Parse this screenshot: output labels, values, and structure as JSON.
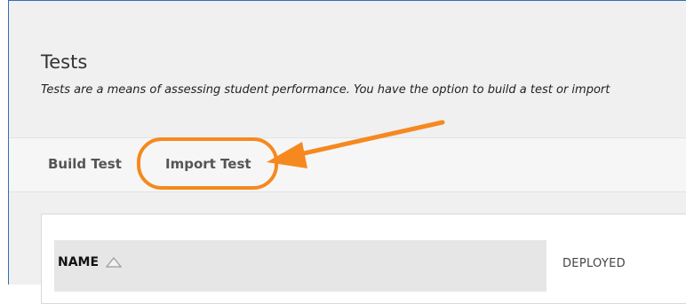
{
  "page": {
    "title": "Tests",
    "description": "Tests are a means of assessing student performance. You have the option to build a test or import"
  },
  "actions": {
    "build_label": "Build Test",
    "import_label": "Import Test"
  },
  "table": {
    "columns": [
      "NAME",
      "DEPLOYED"
    ],
    "sort_icon": "triangle-up-icon"
  },
  "annotation": {
    "color": "#f5891f",
    "highlight_target": "Import Test"
  }
}
